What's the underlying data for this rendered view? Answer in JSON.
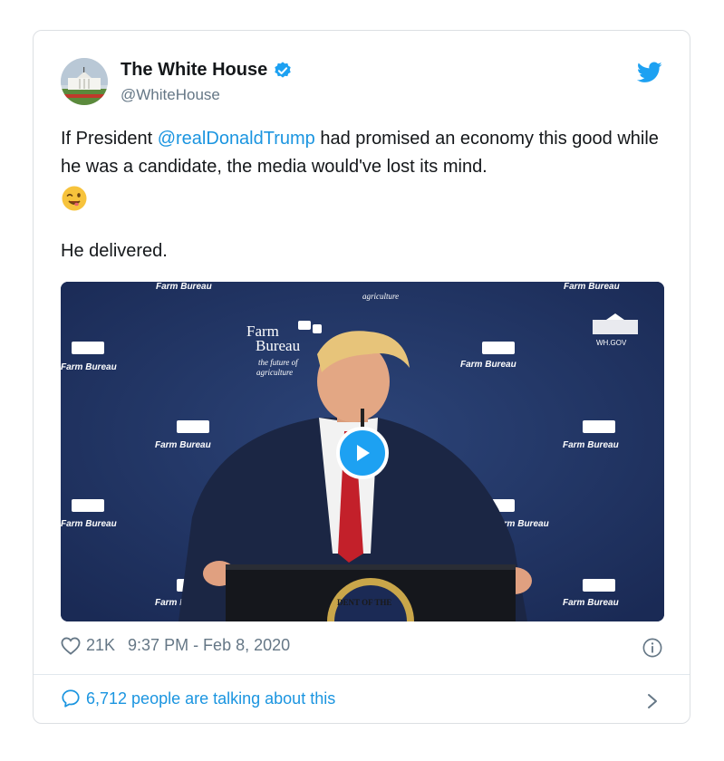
{
  "tweet": {
    "author_name": "The White House",
    "author_handle": "@WhiteHouse",
    "text_before_mention": "If President ",
    "mention": "@realDonaldTrump",
    "text_after_mention": " had promised an economy this good while he was a candidate, the media would've lost its mind.",
    "emoji": "winking-face-with-tongue",
    "paragraph2": "He delivered.",
    "likes": "21K",
    "timestamp": "9:37 PM - Feb 8, 2020",
    "talking": "6,712 people are talking about this"
  },
  "media": {
    "backdrop_brand": "Farm Bureau",
    "backdrop_logo_line1": "Farm",
    "backdrop_logo_line2": "Bureau",
    "backdrop_tagline1": "the future of",
    "backdrop_tagline2": "agriculture",
    "wh_gov": "WH.GOV",
    "seal_text": "DENT OF THE"
  },
  "colors": {
    "accent": "#1da1f2",
    "link": "#1b95e0",
    "text": "#14171a",
    "secondary": "#657786",
    "backdrop": "#20315e"
  },
  "icons": {
    "verified": "verified-badge-icon",
    "twitter": "twitter-bird-icon",
    "heart": "heart-icon",
    "info": "info-icon",
    "reply": "speech-bubble-icon",
    "chevron": "chevron-right-icon",
    "play": "play-icon"
  }
}
